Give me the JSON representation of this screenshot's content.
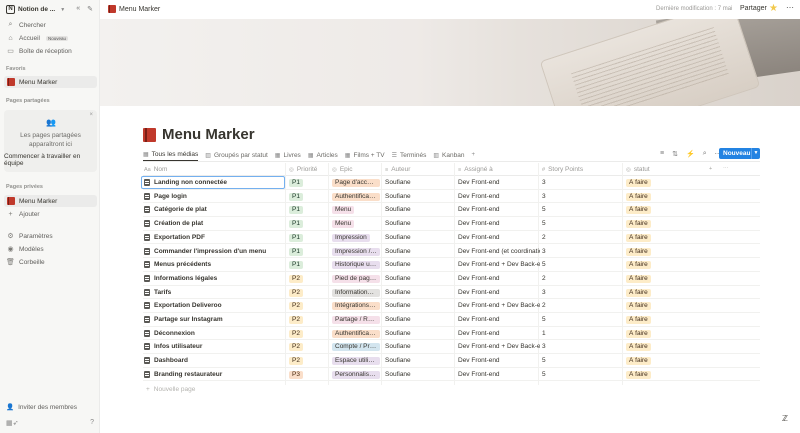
{
  "sidebar": {
    "workspace": "Notion de ...",
    "logo": "N",
    "items": [
      {
        "label": "Chercher",
        "icon": "search-icon"
      },
      {
        "label": "Accueil",
        "icon": "home-icon",
        "badge": "Nouveau"
      },
      {
        "label": "Boîte de réception",
        "icon": "inbox-icon"
      }
    ],
    "favorites_title": "Favoris",
    "favorite": "Menu Marker",
    "shared_title": "Pages partagées",
    "shared_empty_line1": "Les pages partagées",
    "shared_empty_line2": "apparaîtront ici",
    "shared_cta": "Commencer à travailler en équipe",
    "private_title": "Pages privées",
    "private_page": "Menu Marker",
    "add_label": "Ajouter",
    "settings": "Paramètres",
    "templates": "Modèles",
    "trash": "Corbeille",
    "invite": "Inviter des membres"
  },
  "topbar": {
    "breadcrumb": "Menu Marker",
    "modified": "Dernière modification : 7 mai",
    "share": "Partager"
  },
  "page": {
    "title": "Menu Marker"
  },
  "views": {
    "tabs": [
      "Tous les médias",
      "Groupés par statut",
      "Livres",
      "Articles",
      "Films + TV",
      "Terminés",
      "Kanban"
    ],
    "new_label": "Nouveau"
  },
  "table": {
    "headers": [
      "Nom",
      "Priorité",
      "Epic",
      "Auteur",
      "Assigné à",
      "Story Points",
      "statut"
    ],
    "rows": [
      {
        "name": "Landing non connectée",
        "prio": "P1",
        "epic": "Page d'accueil",
        "epic_color": "#fadec9",
        "author": "Soufiane",
        "assign": "Dev Front-end",
        "sp": "3",
        "status": "À faire"
      },
      {
        "name": "Page login",
        "prio": "P1",
        "epic": "Authentification",
        "epic_color": "#fadec9",
        "author": "Soufiane",
        "assign": "Dev Front-end",
        "sp": "3",
        "status": "À faire"
      },
      {
        "name": "Catégorie de plat",
        "prio": "P1",
        "epic": "Menu",
        "epic_color": "#f5e0e9",
        "author": "Soufiane",
        "assign": "Dev Front-end",
        "sp": "5",
        "status": "À faire"
      },
      {
        "name": "Création de plat",
        "prio": "P1",
        "epic": "Menu",
        "epic_color": "#f5e0e9",
        "author": "Soufiane",
        "assign": "Dev Front-end",
        "sp": "5",
        "status": "À faire"
      },
      {
        "name": "Exportation PDF",
        "prio": "P1",
        "epic": "Impression",
        "epic_color": "#e8deee",
        "author": "Soufiane",
        "assign": "Dev Front-end",
        "sp": "2",
        "status": "À faire"
      },
      {
        "name": "Commander l'impression d'un menu",
        "prio": "P1",
        "epic": "Impression / C...",
        "epic_color": "#e8deee",
        "author": "Soufiane",
        "assign": "Dev Front-end (et coordination",
        "sp": "3",
        "status": "À faire"
      },
      {
        "name": "Menus précédents",
        "prio": "P1",
        "epic": "Historique utili...",
        "epic_color": "#e8deee",
        "author": "Soufiane",
        "assign": "Dev Front-end + Dev Back-en",
        "sp": "5",
        "status": "À faire"
      },
      {
        "name": "Informations légales",
        "prio": "P2",
        "epic": "Pied de page /...",
        "epic_color": "#f5e0e9",
        "author": "Soufiane",
        "assign": "Dev Front-end",
        "sp": "2",
        "status": "À faire"
      },
      {
        "name": "Tarifs",
        "prio": "P2",
        "epic": "Informations ...",
        "epic_color": "#e3e2e0",
        "author": "Soufiane",
        "assign": "Dev Front-end",
        "sp": "3",
        "status": "À faire"
      },
      {
        "name": "Exportation Deliveroo",
        "prio": "P2",
        "epic": "Intégrations e...",
        "epic_color": "#fadec9",
        "author": "Soufiane",
        "assign": "Dev Front-end + Dev Back-en",
        "sp": "2",
        "status": "À faire"
      },
      {
        "name": "Partage sur Instagram",
        "prio": "P2",
        "epic": "Partage / Rés...",
        "epic_color": "#f5e0e9",
        "author": "Soufiane",
        "assign": "Dev Front-end",
        "sp": "5",
        "status": "À faire"
      },
      {
        "name": "Déconnexion",
        "prio": "P2",
        "epic": "Authentification",
        "epic_color": "#fadec9",
        "author": "Soufiane",
        "assign": "Dev Front-end",
        "sp": "1",
        "status": "À faire"
      },
      {
        "name": "Infos utilisateur",
        "prio": "P2",
        "epic": "Compte / Profil",
        "epic_color": "#d3e5ef",
        "author": "Soufiane",
        "assign": "Dev Front-end + Dev Back-en",
        "sp": "3",
        "status": "À faire"
      },
      {
        "name": "Dashboard",
        "prio": "P2",
        "epic": "Espace utilisa...",
        "epic_color": "#e8deee",
        "author": "Soufiane",
        "assign": "Dev Front-end",
        "sp": "5",
        "status": "À faire"
      },
      {
        "name": "Branding restaurateur",
        "prio": "P3",
        "epic": "Personnalisati...",
        "epic_color": "#e8deee",
        "author": "Soufiane",
        "assign": "Dev Front-end",
        "sp": "5",
        "status": "À faire"
      }
    ],
    "new_page": "Nouvelle page"
  }
}
